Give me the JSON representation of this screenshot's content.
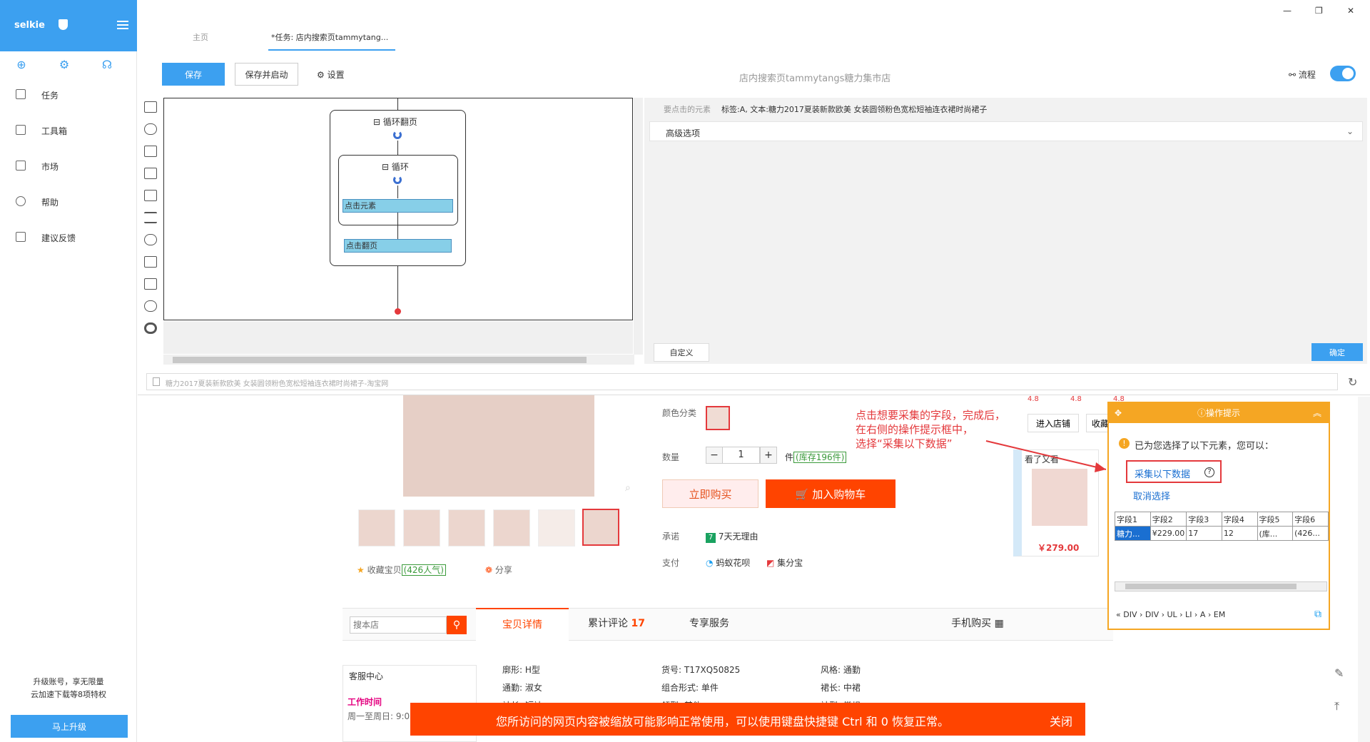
{
  "app": {
    "brand": "selkie",
    "tabs": [
      "主页",
      "*任务: 店内搜索页tammytang..."
    ],
    "doc_title": "店内搜索页tammytangs糖力集市店"
  },
  "sidebar": {
    "items": [
      {
        "label": "任务",
        "icon": "file-icon"
      },
      {
        "label": "工具箱",
        "icon": "toolbox-icon"
      },
      {
        "label": "市场",
        "icon": "bag-icon"
      },
      {
        "label": "帮助",
        "icon": "help-icon"
      },
      {
        "label": "建议反馈",
        "icon": "feedback-icon"
      }
    ],
    "upgrade_tip_1": "升级账号，享无限量",
    "upgrade_tip_2": "云加速下载等8项特权",
    "upgrade_button": "马上升级"
  },
  "toolbar": {
    "save": "保存",
    "save_start": "保存并启动",
    "settings": "设置",
    "flow": "流程",
    "flow_enabled": true
  },
  "workflow": {
    "loop_paging": "循环翻页",
    "loop": "循环",
    "click_element": "点击元素",
    "click_paging": "点击翻页"
  },
  "right_panel": {
    "element_label": "要点击的元素",
    "element_text": "标签:A, 文本:糖力2017夏装新款欧美 女装圆领粉色宽松短袖连衣裙时尚裙子",
    "advanced": "高级选项",
    "custom": "自定义",
    "confirm": "确定"
  },
  "browser": {
    "url": "糖力2017夏装新款欧美 女装圆领粉色宽松短袖连衣裙时尚裙子-淘宝网"
  },
  "product": {
    "color_label": "颜色分类",
    "qty_label": "数量",
    "qty": "1",
    "unit": "件",
    "stock": "(库存196件)",
    "buy_now": "立即购买",
    "add_cart": "加入购物车",
    "promise_label": "承诺",
    "promise": "7天无理由",
    "pay_label": "支付",
    "pay1": "蚂蚁花呗",
    "pay2": "集分宝",
    "fav": "收藏宝贝",
    "fav_count": "(426人气)",
    "share": "分享",
    "enter_shop": "进入店铺",
    "fav_shop": "收藏",
    "also_viewed": "看了又看",
    "also_price": "￥279.00",
    "ratings": [
      "4.8",
      "4.8",
      "4.8"
    ]
  },
  "shop_tabs": {
    "search_placeholder": "搜本店",
    "detail": "宝贝详情",
    "reviews": "累计评论",
    "review_count": "17",
    "service": "专享服务",
    "mobile": "手机购买"
  },
  "customer_service": {
    "title": "客服中心",
    "hours_title": "工作时间",
    "hours": "周一至周日: 9:0"
  },
  "attributes": [
    "廓形: H型",
    "货号: T17XQ50825",
    "风格: 通勤",
    "通勤: 淑女",
    "组合形式: 单件",
    "裙长: 中裙",
    "袖长: 短袖",
    "领型: 其他",
    "袖型: 常规"
  ],
  "annotation": {
    "line1": "点击想要采集的字段，完成后，",
    "line2": "在右侧的操作提示框中，",
    "line3": "选择“采集以下数据”"
  },
  "popup": {
    "title": "操作提示",
    "tip": "已为您选择了以下元素，您可以：",
    "collect": "采集以下数据",
    "cancel": "取消选择",
    "headers": [
      "字段1",
      "字段2",
      "字段3",
      "字段4",
      "字段5",
      "字段6"
    ],
    "row": [
      "糖力...",
      "¥229.00",
      "17",
      "12",
      "(库...",
      "(426..."
    ],
    "crumbs": "«  DIV  ›  DIV  ›  UL  ›  LI  ›  A  ›  EM"
  },
  "banner": {
    "text": "您所访问的网页内容被缩放可能影响正常使用，可以使用键盘快捷键 Ctrl 和 0 恢复正常。",
    "close": "关闭"
  }
}
